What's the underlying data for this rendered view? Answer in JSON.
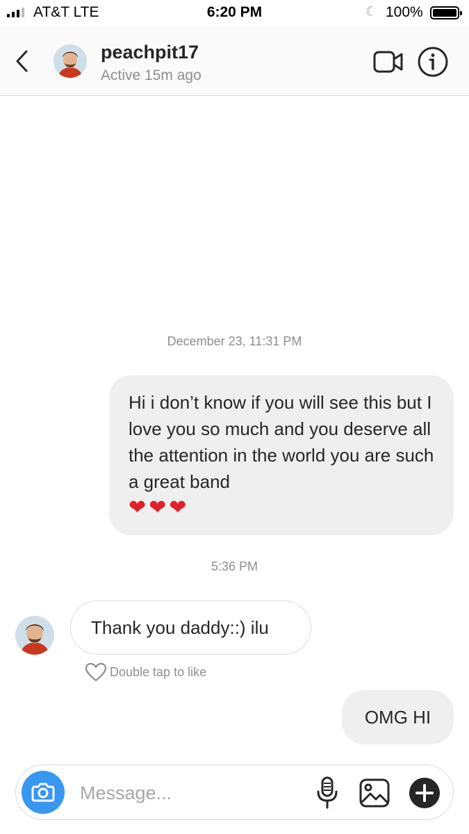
{
  "status_bar": {
    "carrier": "AT&T  LTE",
    "time": "6:20 PM",
    "battery": "100%",
    "icons": [
      "signal-icon",
      "moon-icon",
      "battery-icon"
    ]
  },
  "header": {
    "username": "peachpit17",
    "status": "Active 15m ago",
    "icons": [
      "back-chevron-icon",
      "video-call-icon",
      "info-icon"
    ]
  },
  "conversation": {
    "timestamp_1": "December 23, 11:31 PM",
    "message_1": {
      "text": "Hi i don’t know if you will see this but I love you so much and you deserve all the attention in the world you are such a great band",
      "hearts": "❤❤❤"
    },
    "timestamp_2": "5:36 PM",
    "message_2": {
      "text": "Thank you daddy::) ilu",
      "like_hint": "Double tap to like"
    },
    "message_3": {
      "text": "OMG HI"
    }
  },
  "composer": {
    "placeholder": "Message...",
    "icons": [
      "camera-icon",
      "microphone-icon",
      "gallery-icon",
      "plus-icon"
    ]
  },
  "colors": {
    "accent": "#3897f0",
    "bubble_outgoing": "#efefef",
    "heart": "#e0212b",
    "secondary_text": "#8e8e8e"
  }
}
